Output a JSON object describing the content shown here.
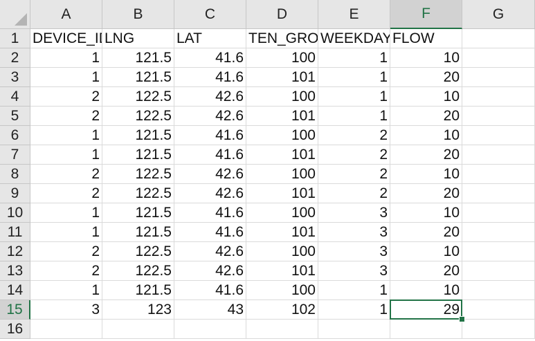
{
  "columns": [
    "A",
    "B",
    "C",
    "D",
    "E",
    "F",
    "G"
  ],
  "row_numbers": [
    "1",
    "2",
    "3",
    "4",
    "5",
    "6",
    "7",
    "8",
    "9",
    "10",
    "11",
    "12",
    "13",
    "14",
    "15",
    "16"
  ],
  "header_row": [
    "DEVICE_ID",
    "LNG",
    "LAT",
    "TEN_GROUP",
    "WEEKDAY",
    "FLOW",
    ""
  ],
  "rows": [
    [
      "1",
      "121.5",
      "41.6",
      "100",
      "1",
      "10"
    ],
    [
      "1",
      "121.5",
      "41.6",
      "101",
      "1",
      "20"
    ],
    [
      "2",
      "122.5",
      "42.6",
      "100",
      "1",
      "10"
    ],
    [
      "2",
      "122.5",
      "42.6",
      "101",
      "1",
      "20"
    ],
    [
      "1",
      "121.5",
      "41.6",
      "100",
      "2",
      "10"
    ],
    [
      "1",
      "121.5",
      "41.6",
      "101",
      "2",
      "20"
    ],
    [
      "2",
      "122.5",
      "42.6",
      "100",
      "2",
      "10"
    ],
    [
      "2",
      "122.5",
      "42.6",
      "101",
      "2",
      "20"
    ],
    [
      "1",
      "121.5",
      "41.6",
      "100",
      "3",
      "10"
    ],
    [
      "1",
      "121.5",
      "41.6",
      "101",
      "3",
      "20"
    ],
    [
      "2",
      "122.5",
      "42.6",
      "100",
      "3",
      "10"
    ],
    [
      "2",
      "122.5",
      "42.6",
      "101",
      "3",
      "20"
    ],
    [
      "1",
      "121.5",
      "41.6",
      "100",
      "1",
      "10"
    ],
    [
      "3",
      "123",
      "43",
      "102",
      "1",
      "29"
    ]
  ],
  "selection": {
    "column": "F",
    "row": "15"
  },
  "colors": {
    "accent": "#217346",
    "header_bg": "#e6e6e6",
    "grid": "#dadada"
  }
}
